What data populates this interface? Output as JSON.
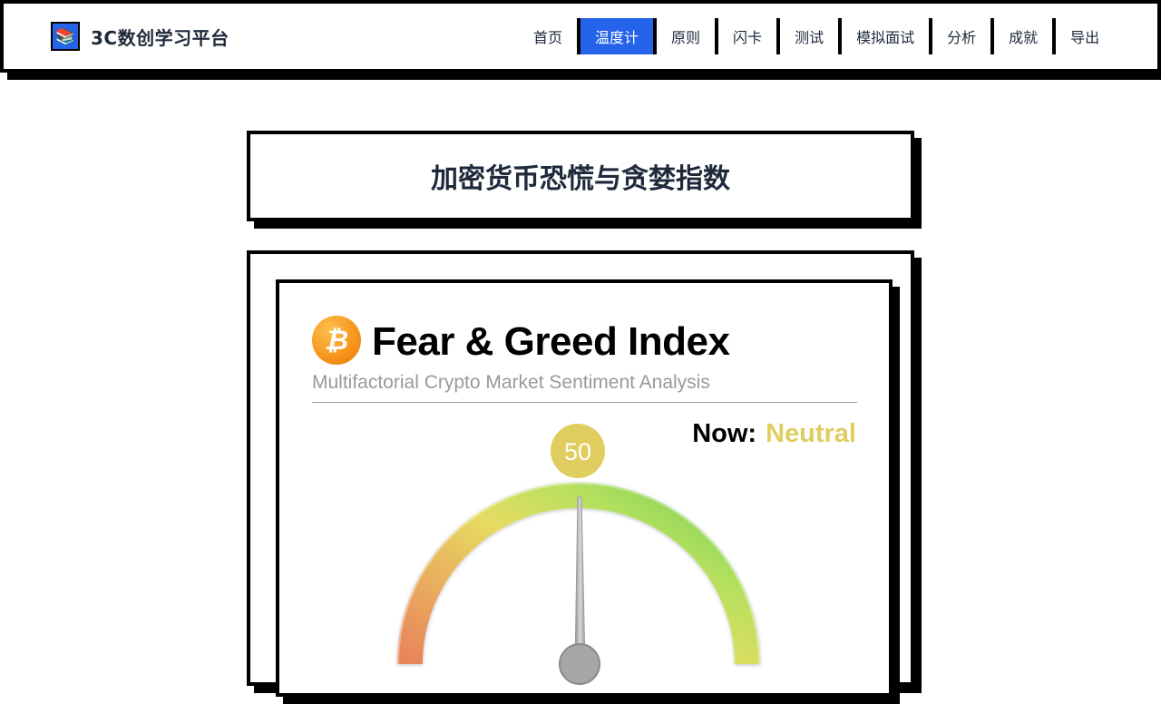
{
  "brand": {
    "name": "3C数创学习平台",
    "logo_icon": "books-icon",
    "logo_glyph": "📚"
  },
  "nav": {
    "items": [
      {
        "label": "首页",
        "active": false
      },
      {
        "label": "温度计",
        "active": true
      },
      {
        "label": "原则",
        "active": false
      },
      {
        "label": "闪卡",
        "active": false
      },
      {
        "label": "测试",
        "active": false
      },
      {
        "label": "模拟面试",
        "active": false
      },
      {
        "label": "分析",
        "active": false
      },
      {
        "label": "成就",
        "active": false
      },
      {
        "label": "导出",
        "active": false
      }
    ]
  },
  "page": {
    "title": "加密货币恐慌与贪婪指数"
  },
  "widget": {
    "icon": "bitcoin-icon",
    "icon_glyph": "₿",
    "title": "Fear & Greed Index",
    "subtitle": "Multifactorial Crypto Market Sentiment Analysis",
    "now_label": "Now:",
    "now_value": "Neutral",
    "score": "50",
    "score_value": 50,
    "colors": {
      "neutral": "#e0cd5f",
      "fear": "#e8845a",
      "greed": "#8ad65a",
      "accent": "#2563eb"
    }
  }
}
